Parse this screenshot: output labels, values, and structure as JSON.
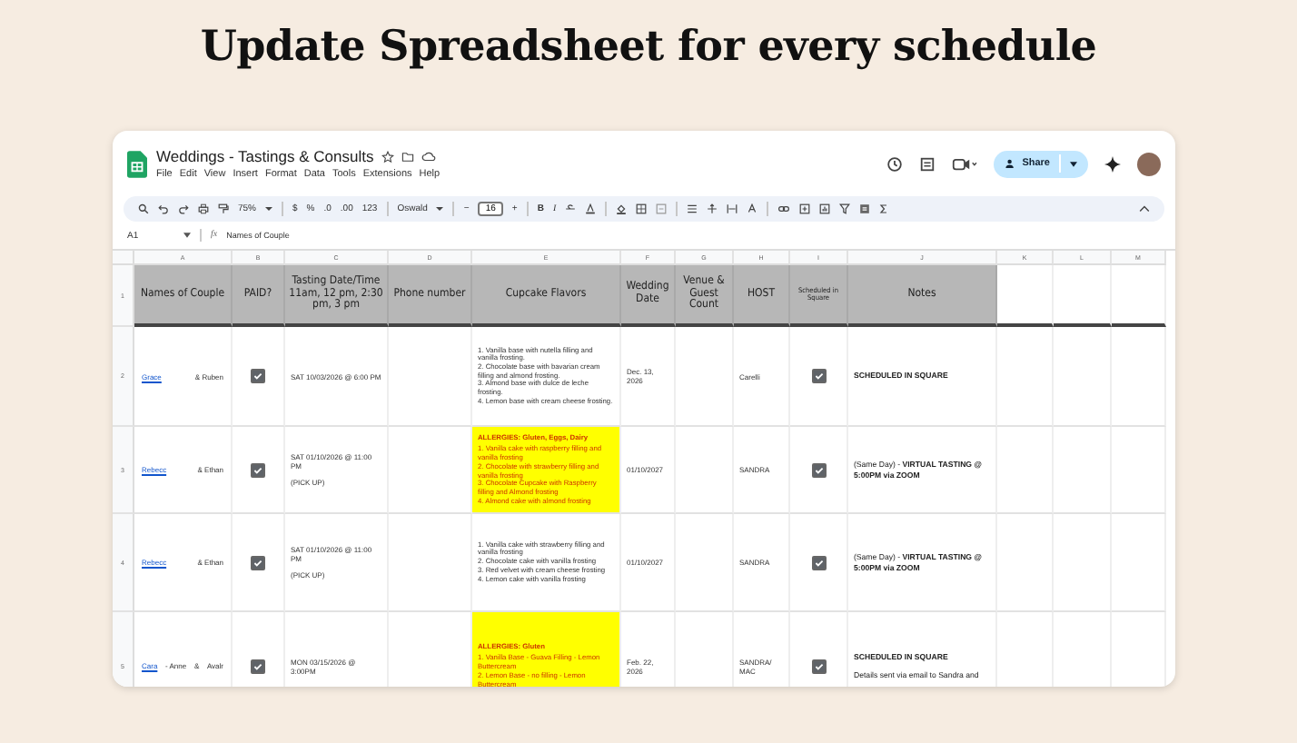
{
  "heading": "Update Spreadsheet for every schedule",
  "sheet": {
    "title": "Weddings - Tastings & Consults",
    "menu": [
      "File",
      "Edit",
      "View",
      "Insert",
      "Format",
      "Data",
      "Tools",
      "Extensions",
      "Help"
    ],
    "share": "Share",
    "toolbar": {
      "zoom": "75%",
      "currency": "$",
      "percent": "%",
      "decimal_decrease": ".0",
      "decimal_increase": ".00",
      "number_format": "123",
      "font": "Oswald",
      "minus": "−",
      "font_size": "16",
      "plus": "+",
      "bold": "B",
      "italic": "I"
    },
    "formula_bar": {
      "cell": "A1",
      "fx": "fx",
      "formula": "Names of Couple"
    },
    "columns": [
      "A",
      "B",
      "C",
      "D",
      "E",
      "F",
      "G",
      "H",
      "I",
      "J",
      "K",
      "L",
      "M"
    ],
    "headers": [
      {
        "label": "Names of Couple",
        "small": false
      },
      {
        "label": "PAID?",
        "small": false
      },
      {
        "label": "Tasting Date/Time 11am, 12 pm, 2:30 pm, 3 pm",
        "small": false
      },
      {
        "label": "Phone number",
        "small": false
      },
      {
        "label": "Cupcake Flavors",
        "small": false
      },
      {
        "label": "Wedding Date",
        "small": false
      },
      {
        "label": "Venue & Guest Count",
        "small": false
      },
      {
        "label": "HOST",
        "small": false
      },
      {
        "label": "Scheduled in Square",
        "small": true
      },
      {
        "label": "Notes",
        "small": false
      }
    ],
    "rows": [
      {
        "number": "1"
      },
      {
        "number": "2",
        "couple": [
          {
            "kind": "link",
            "text": "Grace"
          },
          {
            "kind": "text",
            "text": "& Ruben"
          }
        ],
        "paid": true,
        "tasting": [
          "SAT 10/03/2026 @ 6:00 PM"
        ],
        "cupcake": {
          "highlight": false,
          "items": [
            "1. Vanilla base with nutella filling and vanilla frosting.",
            "2. Chocolate base with bavarian cream filling and almond frosting.",
            "3. Almond base with dulce de leche frosting.",
            "4. Lemon base with cream cheese frosting."
          ]
        },
        "wedding_date": "Dec. 13, 2026",
        "host": "Carelli",
        "scheduled": true,
        "notes": [
          "**SCHEDULED IN SQUARE**"
        ]
      },
      {
        "number": "3",
        "couple": [
          {
            "kind": "link",
            "text": "Rebecc"
          },
          {
            "kind": "text",
            "text": "& Ethan"
          }
        ],
        "paid": true,
        "tasting": [
          "SAT 01/10/2026 @ 11:00 PM",
          "(PICK UP)"
        ],
        "cupcake": {
          "highlight": true,
          "allergies": "ALLERGIES: Gluten, Eggs, Dairy",
          "items": [
            "1. Vanilla cake with raspberry filling and vanilla frosting",
            "2. Chocolate with strawberry filling and vanilla frosting",
            "3. Chocolate Cupcake with Raspberry filling and Almond frosting",
            "4. Almond cake with almond frosting"
          ]
        },
        "wedding_date": "01/10/2027",
        "host": "SANDRA",
        "scheduled": true,
        "notes": [
          "(Same Day) - **VIRTUAL TASTING @ 5:00PM via ZOOM**"
        ]
      },
      {
        "number": "4",
        "couple": [
          {
            "kind": "link",
            "text": "Rebecc"
          },
          {
            "kind": "text",
            "text": "& Ethan"
          }
        ],
        "paid": true,
        "tasting": [
          "SAT 01/10/2026 @ 11:00 PM",
          "(PICK UP)"
        ],
        "cupcake": {
          "highlight": false,
          "items": [
            "1. Vanilla cake with strawberry filling and vanilla frosting",
            "2. Chocolate cake with vanilla frosting",
            "3. Red velvet with cream cheese frosting",
            "4. Lemon cake with vanilla frosting"
          ]
        },
        "wedding_date": "01/10/2027",
        "host": "SANDRA",
        "scheduled": true,
        "notes": [
          "(Same Day) - **VIRTUAL TASTING @ 5:00PM via ZOOM**"
        ]
      },
      {
        "number": "5",
        "couple": [
          {
            "kind": "link",
            "text": "Cara"
          },
          {
            "kind": "text",
            "text": "- Anne"
          },
          {
            "kind": "text",
            "text": "&"
          },
          {
            "kind": "text",
            "text": "Avalr"
          }
        ],
        "paid": true,
        "tasting": [
          "MON 03/15/2026 @ 3:00PM"
        ],
        "cupcake": {
          "highlight": true,
          "allergies": "ALLERGIES: Gluten",
          "items": [
            "1. Vanilla Base - Guava Filling - Lemon Buttercream",
            "2. Lemon Base - no filling - Lemon Buttercream"
          ]
        },
        "wedding_date": "Feb. 22, 2026",
        "host": "SANDRA/ MAC",
        "scheduled": true,
        "notes": [
          "**SCHEDULED IN SQUARE**",
          "Details sent via email to Sandra and"
        ]
      }
    ]
  }
}
